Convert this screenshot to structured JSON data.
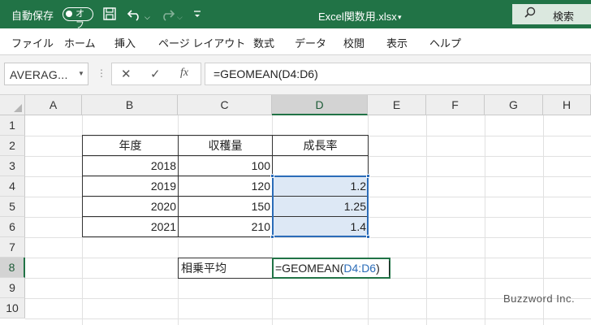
{
  "titlebar": {
    "autosave_label": "自動保存",
    "autosave_state": "オフ",
    "filename": "Excel関数用.xlsx",
    "search_label": "検索"
  },
  "menu": [
    "ファイル",
    "ホーム",
    "挿入",
    "ページ レイアウト",
    "数式",
    "データ",
    "校閲",
    "表示",
    "ヘルプ"
  ],
  "formula_bar": {
    "name_box": "AVERAG...",
    "fx_label": "fx",
    "formula": "=GEOMEAN(D4:D6)"
  },
  "columns": [
    "A",
    "B",
    "C",
    "D",
    "E",
    "F",
    "G",
    "H"
  ],
  "rows": [
    "1",
    "2",
    "3",
    "4",
    "5",
    "6",
    "7",
    "8",
    "9",
    "10"
  ],
  "table": {
    "headers": [
      "年度",
      "収穫量",
      "成長率"
    ],
    "rows": [
      [
        "2018",
        "100",
        ""
      ],
      [
        "2019",
        "120",
        "1.2"
      ],
      [
        "2020",
        "150",
        "1.25"
      ],
      [
        "2021",
        "210",
        "1.4"
      ]
    ]
  },
  "geomean": {
    "label": "相乗平均",
    "formula_prefix": "=GEOMEAN(",
    "formula_ref": "D4:D6",
    "formula_suffix": ")"
  },
  "watermark": "Buzzword Inc.",
  "colors": {
    "accent": "#217346",
    "reference": "#2b6cb8",
    "selection_fill": "#dde8f5"
  },
  "icons": [
    "save-icon",
    "undo-icon",
    "redo-icon",
    "customize-icon",
    "search-icon",
    "cancel-icon",
    "enter-icon",
    "function-icon"
  ]
}
